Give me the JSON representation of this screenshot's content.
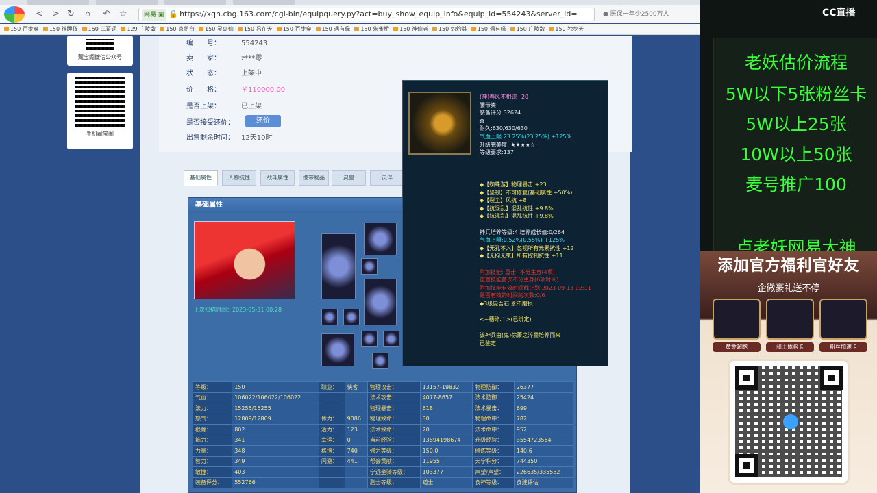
{
  "browser": {
    "url": "https://xqn.cbg.163.com/cgi-bin/equipquery.py?act=buy_show_equip_info&equip_id=554243&server_id=",
    "site_tag": "网易 ▣",
    "search_hint": "医保一年少2500万人",
    "nav": {
      "back": "<",
      "forward": ">",
      "reload": "↻",
      "home": "⌂",
      "undo": "↶",
      "star": "☆"
    },
    "bookmarks": [
      "150 百步穿",
      "150 神睡孩",
      "150 三哥词",
      "129 广陵散",
      "150 点将台",
      "150 灵岛仙",
      "150 吕在天",
      "150 百步穿",
      "150 遇有缘",
      "150 朱雀桥",
      "150 神仙者",
      "150 灼灼其",
      "150 遇有缘",
      "150 广陵散",
      "150 独步天"
    ]
  },
  "sidebar": {
    "qr1_caption": "藏宝阁微信公众号",
    "qr2_caption": "手机藏宝阁"
  },
  "item_info": {
    "rows": [
      {
        "key": "编　　号：",
        "value": "554243"
      },
      {
        "key": "卖　　家：",
        "value": "z***零"
      },
      {
        "key": "状　　态：",
        "value": "上架中"
      },
      {
        "key": "价　　格：",
        "value": "￥110000.00"
      },
      {
        "key": "是否上架：",
        "value": "已上架"
      },
      {
        "key": "是否接受还价：",
        "value": ""
      },
      {
        "key": "出售剩余时间：",
        "value": "12天10时"
      }
    ],
    "counter_offer_button": "还价"
  },
  "tabs": [
    "基础属性",
    "人物抗性",
    "战斗属性",
    "携带物品",
    "灵兽",
    "灵伴"
  ],
  "panel": {
    "title": "基础属性",
    "captured_time": "上次扫描时间：2023-05-31 00:28"
  },
  "stats": [
    [
      "等级：",
      "150",
      "职业：",
      "侠客",
      "物理攻击：",
      "13157-19832",
      "物理防御：",
      "26377"
    ],
    [
      "气血：",
      "106022/106022/106022",
      "",
      "",
      "法术攻击：",
      "4077-8657",
      "法术防御：",
      "25424"
    ],
    [
      "法力：",
      "15255/15255",
      "",
      "",
      "物理暴击：",
      "618",
      "法术暴击：",
      "699"
    ],
    [
      "怒气：",
      "12809/12809",
      "体力：",
      "9086",
      "物理致命：",
      "30",
      "物理命中：",
      "782"
    ],
    [
      "根骨：",
      "802",
      "活力：",
      "123",
      "法术致命：",
      "20",
      "法术命中：",
      "952"
    ],
    [
      "筋力：",
      "341",
      "幸运：",
      "0",
      "当前经验：",
      "13894198674",
      "升级经验：",
      "3554723564"
    ],
    [
      "力量：",
      "348",
      "格挡：",
      "740",
      "修为等级：",
      "150.0",
      "修炼等级：",
      "140.6"
    ],
    [
      "智力：",
      "349",
      "闪避：",
      "441",
      "帮会贡献：",
      "11955",
      "天宁积分：",
      "744350"
    ],
    [
      "敏捷：",
      "403",
      "",
      "",
      "宁远坐骑等级：",
      "103377",
      "声望/声望：",
      "226635/335582"
    ],
    [
      "装备评分：",
      "552766",
      "",
      "",
      "副士等级：",
      "道士",
      "食神等级：",
      "食建评估"
    ]
  ],
  "tooltip": {
    "block1": [
      {
        "text": "(神)春风不相识+20",
        "color": "pink"
      },
      {
        "text": "腰带类",
        "color": "white"
      },
      {
        "text": "装备评分:32624",
        "color": "white"
      },
      {
        "text": "◍",
        "color": "white"
      },
      {
        "text": "耐久:630/630/630",
        "color": "white"
      },
      {
        "text": "气血上限:23.25%(23.25%) +125%",
        "color": "cyan"
      },
      {
        "text": "升级完美度: ★★★★☆",
        "color": "white"
      },
      {
        "text": "等级要求:137",
        "color": "white"
      }
    ],
    "block2": [
      {
        "text": "◆【蜘蛛游】物理暴击 +23",
        "color": "yellow"
      },
      {
        "text": "◆【坚韧】不可修复(基础属性 +50%)",
        "color": "yellow"
      },
      {
        "text": "◆【裂尘】风抗 +8",
        "color": "yellow"
      },
      {
        "text": "◆【抗混乱】混乱抗性 +9.8%",
        "color": "yellow"
      },
      {
        "text": "◆【抗混乱】混乱抗性 +9.8%",
        "color": "yellow"
      },
      {
        "text": "",
        "color": "white"
      },
      {
        "text": "神兵培养等级:4 培养成长值:0/264",
        "color": "white"
      },
      {
        "text": "气血上限:0.52%(0.55%) +125%",
        "color": "cyan"
      },
      {
        "text": "◆【无孔不入】忽视所有元素抗性 +12",
        "color": "yellow"
      },
      {
        "text": "◆【无拘无束】所有控制抗性 +11",
        "color": "yellow"
      },
      {
        "text": "",
        "color": "white"
      },
      {
        "text": "附加技能: 重击: 不分主身(4项)",
        "color": "red"
      },
      {
        "text": "重置技能首次不分主身(6项时间)",
        "color": "red"
      },
      {
        "text": "附加技能有效时间截止到:2023-09-13 02:11",
        "color": "red"
      },
      {
        "text": "是否有效的时间的次数:0/6",
        "color": "red"
      },
      {
        "text": "◆3级昆吾石:永不磨损",
        "color": "yellow"
      },
      {
        "text": "",
        "color": "white"
      },
      {
        "text": "<~穗碎.↑>(已绑定)",
        "color": "yellow"
      },
      {
        "text": "",
        "color": "white"
      },
      {
        "text": "该神兵由(鬼)徐萧之淬靈培养而来",
        "color": "yellow"
      },
      {
        "text": "已鉴定",
        "color": "yellow"
      }
    ]
  },
  "stream": {
    "platform": "CC直播",
    "announce": [
      "老妖估价流程",
      "5W以下5张粉丝卡",
      "5W以上25张",
      "10W以上50张",
      "麦号推广100",
      "点老妖网易大神"
    ],
    "promo_title": "添加官方福利官好友",
    "promo_sub": "企微豪礼送不停",
    "gifts": [
      "黄金超跑",
      "骑士体验卡",
      "粉丝加速卡"
    ],
    "colors": {
      "announce": "#39ff39",
      "price": "#ea62b6"
    }
  }
}
